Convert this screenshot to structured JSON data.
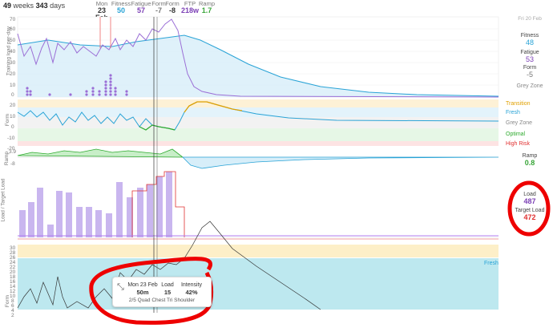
{
  "header": {
    "weeks": "49",
    "weeks_label": "weeks",
    "days": "343",
    "days_label": "days",
    "metrics": [
      {
        "label": "Mon",
        "value": "23 Feb",
        "color": "#333333"
      },
      {
        "label": "Fitness",
        "value": "50",
        "color": "#29a3d6"
      },
      {
        "label": "Fatigue",
        "value": "57",
        "color": "#7b3fb5"
      },
      {
        "label": "Form",
        "value": "-7",
        "color": "#777777"
      },
      {
        "label": "Form",
        "value": "-8",
        "color": "#333333"
      },
      {
        "label": "FTP",
        "value": "218w",
        "color": "#7b3fb5"
      },
      {
        "label": "Ramp",
        "value": "1.7",
        "color": "#37a537"
      }
    ]
  },
  "right_panel": {
    "date": "Fri 20 Feb",
    "fitness_label": "Fitness",
    "fitness_value": "48",
    "fatigue_label": "Fatigue",
    "fatigue_value": "53",
    "form_label": "Form",
    "form_value": "-5",
    "zone_label": "Grey Zone",
    "zones": [
      {
        "label": "Transition",
        "color": "#e0a000"
      },
      {
        "label": "Fresh",
        "color": "#29a3d6"
      },
      {
        "label": "Grey Zone",
        "color": "#888888"
      },
      {
        "label": "Optimal",
        "color": "#2eaa2e"
      },
      {
        "label": "High Risk",
        "color": "#e03030"
      }
    ],
    "ramp_label": "Ramp",
    "ramp_value": "0.8",
    "load_label": "Load",
    "load_value": "487",
    "target_label": "Target Load",
    "target_value": "472"
  },
  "axis_labels": {
    "training_load": "Training load per-day",
    "form": "Form",
    "ramp": "Ramp",
    "load": "Load / Target Load",
    "form2": "Form",
    "fresh": "Fresh"
  },
  "ticks": {
    "tl": [
      "70",
      "60",
      "50",
      "40",
      "30",
      "20",
      "10",
      "0"
    ],
    "form": [
      "20",
      "10",
      "0",
      "-10",
      "-20"
    ],
    "ramp": [
      "3.9",
      "-8"
    ],
    "form2": [
      "30",
      "28",
      "26",
      "24",
      "22",
      "20",
      "18",
      "16",
      "14",
      "12",
      "10",
      "8",
      "6",
      "4",
      "2"
    ]
  },
  "tooltip": {
    "date": "Mon 23 Feb",
    "duration": "50m",
    "load_label": "Load",
    "load_value": "15",
    "intensity_label": "Intensity",
    "intensity_value": "42%",
    "description": "2/5 Quad Chest Tri Shoulder"
  },
  "colors": {
    "fitness": "#29a3d6",
    "fatigue": "#9b6fd6",
    "load_bar": "#c9b6ef",
    "annotation": "#ee0000"
  }
}
